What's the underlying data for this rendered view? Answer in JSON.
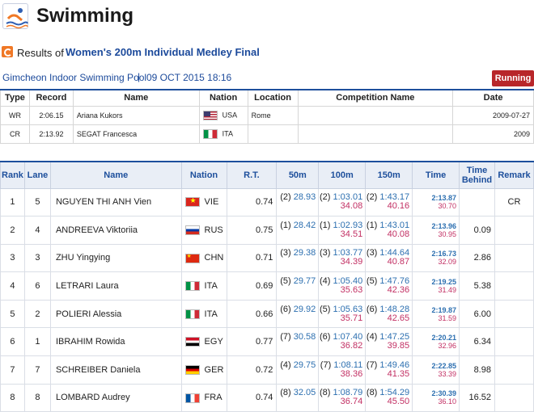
{
  "header": {
    "app_title": "Swimming",
    "logo_icon": "swimming-logo-icon"
  },
  "results": {
    "prefix": "Results of",
    "event": "Women's 200m Individual Medley Final"
  },
  "venue": {
    "name": "Gimcheon Indoor Swimming Pool",
    "separator": "|",
    "datetime": "09 OCT 2015 18:16",
    "status": "Running"
  },
  "records": {
    "headers": [
      "Type",
      "Record",
      "Name",
      "Nation",
      "Location",
      "Competition Name",
      "Date"
    ],
    "rows": [
      {
        "type": "WR",
        "record": "2:06.15",
        "name": "Ariana Kukors",
        "nation": "USA",
        "flag": "usa",
        "location": "Rome",
        "competition": "",
        "date": "2009-07-27"
      },
      {
        "type": "CR",
        "record": "2:13.92",
        "name": "SEGAT Francesca",
        "nation": "ITA",
        "flag": "ita",
        "location": "",
        "competition": "",
        "date": "2009"
      }
    ]
  },
  "table": {
    "headers": {
      "rank": "Rank",
      "lane": "Lane",
      "name": "Name",
      "nation": "Nation",
      "rt": "R.T.",
      "m50": "50m",
      "m100": "100m",
      "m150": "150m",
      "time": "Time",
      "behind": "Time Behind",
      "remark": "Remark"
    },
    "rows": [
      {
        "rank": "1",
        "lane": "5",
        "name": "NGUYEN THI ANH Vien",
        "nation": "VIE",
        "flag": "vie",
        "rt": "0.74",
        "s50_pos": "(2)",
        "s50": "28.93",
        "s100_pos": "(2)",
        "s100": "1:03.01",
        "s100_split": "34.08",
        "s150_pos": "(2)",
        "s150": "1:43.17",
        "s150_split": "40.16",
        "time": "2:13.87",
        "time_split": "30.70",
        "behind": "",
        "remark": "CR"
      },
      {
        "rank": "2",
        "lane": "4",
        "name": "ANDREEVA Viktoriia",
        "nation": "RUS",
        "flag": "rus",
        "rt": "0.75",
        "s50_pos": "(1)",
        "s50": "28.42",
        "s100_pos": "(1)",
        "s100": "1:02.93",
        "s100_split": "34.51",
        "s150_pos": "(1)",
        "s150": "1:43.01",
        "s150_split": "40.08",
        "time": "2:13.96",
        "time_split": "30.95",
        "behind": "0.09",
        "remark": ""
      },
      {
        "rank": "3",
        "lane": "3",
        "name": "ZHU Yingying",
        "nation": "CHN",
        "flag": "chn",
        "rt": "0.71",
        "s50_pos": "(3)",
        "s50": "29.38",
        "s100_pos": "(3)",
        "s100": "1:03.77",
        "s100_split": "34.39",
        "s150_pos": "(3)",
        "s150": "1:44.64",
        "s150_split": "40.87",
        "time": "2:16.73",
        "time_split": "32.09",
        "behind": "2.86",
        "remark": ""
      },
      {
        "rank": "4",
        "lane": "6",
        "name": "LETRARI Laura",
        "nation": "ITA",
        "flag": "ita",
        "rt": "0.69",
        "s50_pos": "(5)",
        "s50": "29.77",
        "s100_pos": "(4)",
        "s100": "1:05.40",
        "s100_split": "35.63",
        "s150_pos": "(5)",
        "s150": "1:47.76",
        "s150_split": "42.36",
        "time": "2:19.25",
        "time_split": "31.49",
        "behind": "5.38",
        "remark": ""
      },
      {
        "rank": "5",
        "lane": "2",
        "name": "POLIERI Alessia",
        "nation": "ITA",
        "flag": "ita",
        "rt": "0.66",
        "s50_pos": "(6)",
        "s50": "29.92",
        "s100_pos": "(5)",
        "s100": "1:05.63",
        "s100_split": "35.71",
        "s150_pos": "(6)",
        "s150": "1:48.28",
        "s150_split": "42.65",
        "time": "2:19.87",
        "time_split": "31.59",
        "behind": "6.00",
        "remark": ""
      },
      {
        "rank": "6",
        "lane": "1",
        "name": "IBRAHIM Rowida",
        "nation": "EGY",
        "flag": "egy",
        "rt": "0.77",
        "s50_pos": "(7)",
        "s50": "30.58",
        "s100_pos": "(6)",
        "s100": "1:07.40",
        "s100_split": "36.82",
        "s150_pos": "(4)",
        "s150": "1:47.25",
        "s150_split": "39.85",
        "time": "2:20.21",
        "time_split": "32.96",
        "behind": "6.34",
        "remark": ""
      },
      {
        "rank": "7",
        "lane": "7",
        "name": "SCHREIBER Daniela",
        "nation": "GER",
        "flag": "ger",
        "rt": "0.72",
        "s50_pos": "(4)",
        "s50": "29.75",
        "s100_pos": "(7)",
        "s100": "1:08.11",
        "s100_split": "38.36",
        "s150_pos": "(7)",
        "s150": "1:49.46",
        "s150_split": "41.35",
        "time": "2:22.85",
        "time_split": "33.39",
        "behind": "8.98",
        "remark": ""
      },
      {
        "rank": "8",
        "lane": "8",
        "name": "LOMBARD Audrey",
        "nation": "FRA",
        "flag": "fra",
        "rt": "0.74",
        "s50_pos": "(8)",
        "s50": "32.05",
        "s100_pos": "(8)",
        "s100": "1:08.79",
        "s100_split": "36.74",
        "s150_pos": "(8)",
        "s150": "1:54.29",
        "s150_split": "45.50",
        "time": "2:30.39",
        "time_split": "36.10",
        "behind": "16.52",
        "remark": ""
      }
    ]
  },
  "colors": {
    "accent_blue": "#1d4f9c",
    "time_blue": "#2c6fb0",
    "split_pink": "#c22f63",
    "status_red": "#b8262a",
    "header_bg": "#e9eef6"
  }
}
